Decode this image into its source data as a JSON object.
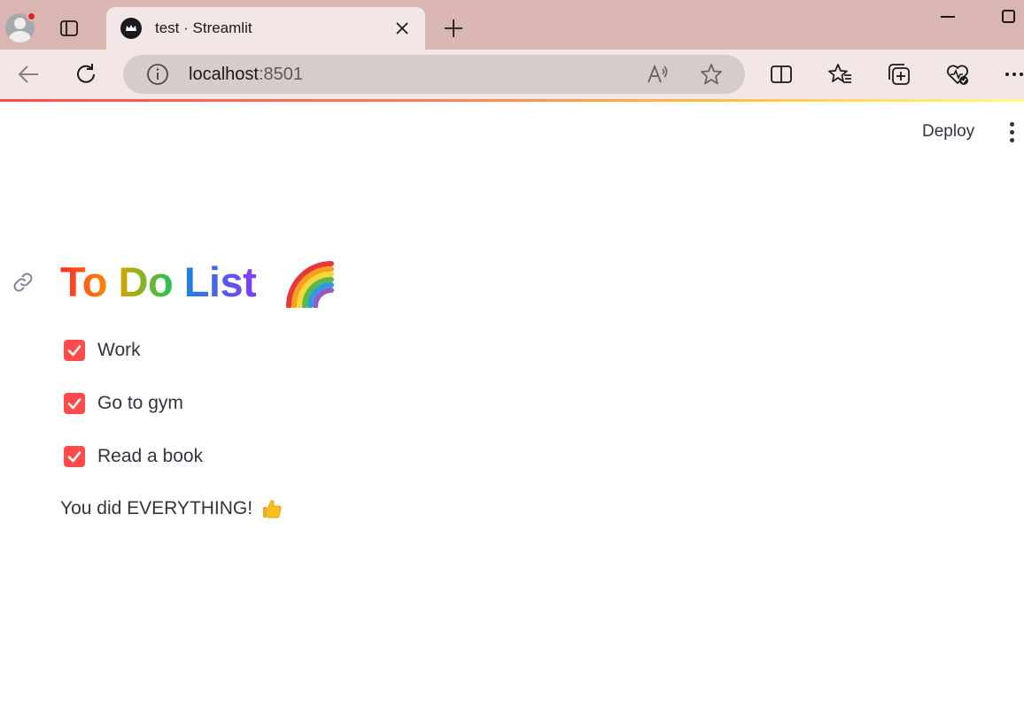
{
  "browser": {
    "tab_title": "test · Streamlit",
    "url_host": "localhost",
    "url_port": ":8501",
    "accent": "#ff4b4b"
  },
  "icons": [
    "profile-icon",
    "tab-actions-icon",
    "streamlit-favicon",
    "close-icon",
    "new-tab-icon",
    "minimize-icon",
    "maximize-icon",
    "back-icon",
    "refresh-icon",
    "info-icon",
    "read-aloud-icon",
    "favorite-star-icon",
    "split-screen-icon",
    "favorites-icon",
    "collections-icon",
    "browser-essentials-icon",
    "more-icon",
    "link-icon",
    "rainbow-icon",
    "checkmark-icon",
    "thumbs-up-icon"
  ],
  "app": {
    "deploy_label": "Deploy",
    "title": {
      "word1": "To",
      "word2": "Do",
      "word3": "List"
    },
    "tasks": [
      {
        "label": "Work",
        "checked": true
      },
      {
        "label": "Go to gym",
        "checked": true
      },
      {
        "label": "Read a book",
        "checked": true
      }
    ],
    "done_message": "You did EVERYTHING!"
  }
}
